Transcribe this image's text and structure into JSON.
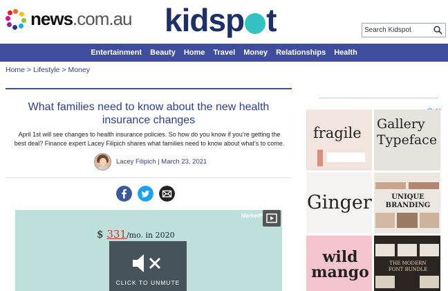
{
  "header": {
    "news_brand": "news",
    "news_suffix": ".com.au",
    "site_logo": "kidspot",
    "search_placeholder": "Search Kidspot"
  },
  "nav": {
    "items": [
      "Entertainment",
      "Beauty",
      "Home",
      "Travel",
      "Money",
      "Relationships",
      "Health"
    ]
  },
  "breadcrumb": "Home > Lifestyle > Money",
  "article": {
    "title": "What families need to know about the new health insurance changes",
    "intro": "April 1st will see changes to health insurance policies. So how do you know if you’re getting the best deal? Finance expert Lacey Filipich shares what families need to know about what’s to come.",
    "byline": "Lacey Filipich | March 23, 2021"
  },
  "video": {
    "price_prefix": "$",
    "price_number": "331",
    "price_suffix": "/mo. in 2020",
    "brand": "MarketPl",
    "unmute_label": "CLICK TO UNMUTE"
  },
  "ads": {
    "tiles": [
      "fragile",
      "Gallery Typeface",
      "Ginger",
      "UNIQUE BRANDING",
      "wild mango",
      "THE MODERN FONT BUNDLE"
    ]
  },
  "colors": {
    "brand_blue": "#3e4e9c",
    "link_blue": "#2d3f8c",
    "kidspot_teal": "#33c3c3",
    "facebook": "#3b5998",
    "twitter": "#1da1f2"
  }
}
